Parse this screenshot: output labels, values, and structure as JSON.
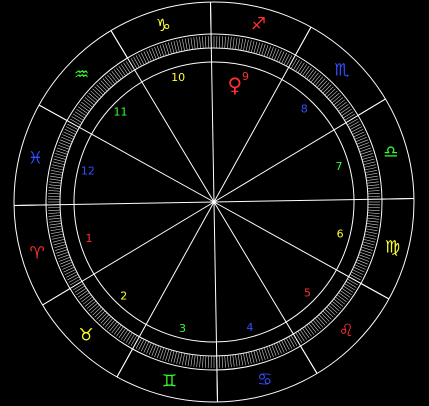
{
  "chart": {
    "background": "#000000",
    "line_color": "#ffffff",
    "cusp_color": "#ffffff",
    "tick_color": "#d0d0d0"
  },
  "signs": [
    {
      "name": "aries",
      "glyph": "♈",
      "color": "#ff3030",
      "icon": "aries-icon"
    },
    {
      "name": "taurus",
      "glyph": "♉",
      "color": "#ffff30",
      "icon": "taurus-icon"
    },
    {
      "name": "gemini",
      "glyph": "♊",
      "color": "#30ff30",
      "icon": "gemini-icon"
    },
    {
      "name": "cancer",
      "glyph": "♋",
      "color": "#3050ff",
      "icon": "cancer-icon"
    },
    {
      "name": "leo",
      "glyph": "♌",
      "color": "#ff3030",
      "icon": "leo-icon"
    },
    {
      "name": "virgo",
      "glyph": "♍",
      "color": "#ffff30",
      "icon": "virgo-icon"
    },
    {
      "name": "libra",
      "glyph": "♎",
      "color": "#30ff30",
      "icon": "libra-icon"
    },
    {
      "name": "scorpio",
      "glyph": "♏",
      "color": "#3050ff",
      "icon": "scorpio-icon"
    },
    {
      "name": "sagittarius",
      "glyph": "♐",
      "color": "#ff3030",
      "icon": "sagittarius-icon"
    },
    {
      "name": "capricorn",
      "glyph": "♑",
      "color": "#ffff30",
      "icon": "capricorn-icon"
    },
    {
      "name": "aquarius",
      "glyph": "♒",
      "color": "#30ff30",
      "icon": "aquarius-icon"
    },
    {
      "name": "pisces",
      "glyph": "♓",
      "color": "#3050ff",
      "icon": "pisces-icon"
    }
  ],
  "houses": [
    {
      "label": "1",
      "color": "#ff3030"
    },
    {
      "label": "2",
      "color": "#ffff30"
    },
    {
      "label": "3",
      "color": "#30ff30"
    },
    {
      "label": "4",
      "color": "#3050ff"
    },
    {
      "label": "5",
      "color": "#ff3030"
    },
    {
      "label": "6",
      "color": "#ffff30"
    },
    {
      "label": "7",
      "color": "#30ff30"
    },
    {
      "label": "8",
      "color": "#3050ff"
    },
    {
      "label": "9",
      "color": "#ff3030"
    },
    {
      "label": "10",
      "color": "#ffff30"
    },
    {
      "label": "11",
      "color": "#30ff30"
    },
    {
      "label": "12",
      "color": "#3050ff"
    }
  ],
  "planets": [
    {
      "name": "venus",
      "glyph": "♀",
      "color": "#ff3030",
      "icon": "venus-icon"
    }
  ]
}
